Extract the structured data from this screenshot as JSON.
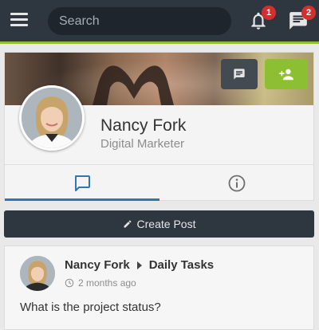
{
  "header": {
    "search_placeholder": "Search",
    "notifications_count": "1",
    "messages_count": "2"
  },
  "profile": {
    "name": "Nancy Fork",
    "role": "Digital Marketer"
  },
  "tabs": {
    "active": "posts"
  },
  "create_post": {
    "label": "Create Post"
  },
  "post": {
    "author": "Nancy Fork",
    "group": "Daily Tasks",
    "time": "2 months ago",
    "text": "What is the project status?"
  },
  "colors": {
    "topbar": "#2e3740",
    "accent_green": "#8dbf32",
    "tab_active": "#2f76b5",
    "badge": "#d32f2f"
  },
  "icons": {
    "menu": "hamburger-icon",
    "notifications": "bell-icon",
    "messages": "chat-icon",
    "cover_message": "message-icon",
    "cover_add": "add-friend-icon",
    "tab_posts": "chat-bubble-icon",
    "tab_info": "info-icon",
    "create_post": "pencil-icon",
    "post_separator": "caret-right-icon",
    "post_time": "clock-icon"
  }
}
